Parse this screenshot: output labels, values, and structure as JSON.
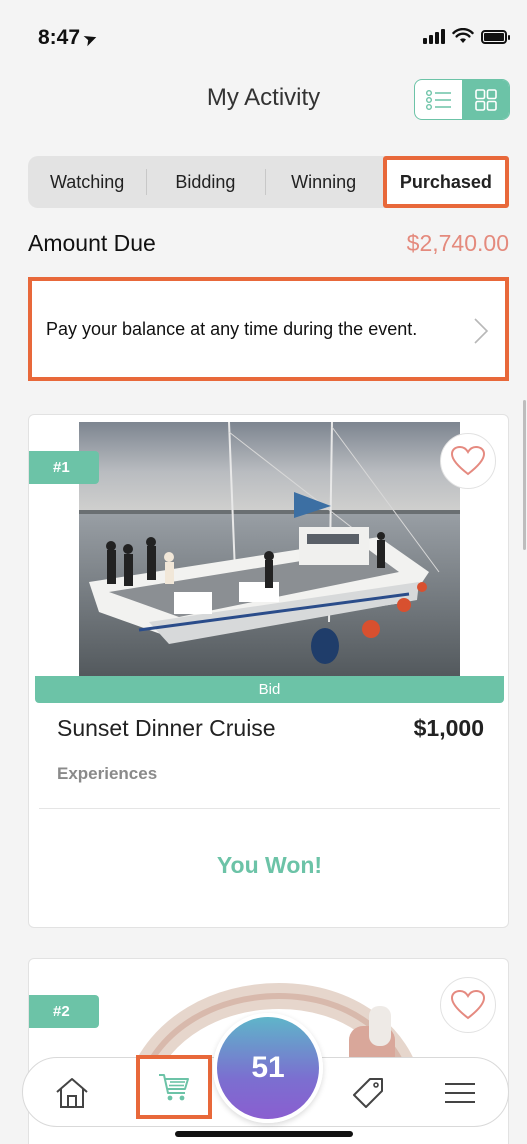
{
  "status_bar": {
    "time": "8:47",
    "location_icon": "location-arrow-icon",
    "icons": [
      "signal-icon",
      "wifi-icon",
      "battery-icon"
    ]
  },
  "header": {
    "title": "My Activity",
    "view_toggle": {
      "options": [
        "list-view-icon",
        "grid-view-icon"
      ],
      "active": "grid-view-icon"
    }
  },
  "tabs": [
    {
      "label": "Watching",
      "active": false
    },
    {
      "label": "Bidding",
      "active": false
    },
    {
      "label": "Winning",
      "active": false
    },
    {
      "label": "Purchased",
      "active": true
    }
  ],
  "amount_due": {
    "label": "Amount Due",
    "value": "$2,740.00"
  },
  "balance_notice": {
    "text": "Pay your balance at any time during the event."
  },
  "items": [
    {
      "rank": "#1",
      "status": "Bid",
      "title": "Sunset Dinner Cruise",
      "price": "$1,000",
      "category": "Experiences",
      "result": "You Won!",
      "image": "catamaran-dinner-photo"
    },
    {
      "rank": "#2",
      "image": "headphones-photo"
    }
  ],
  "bottom_nav": {
    "items": [
      "home-icon",
      "cart-icon",
      "tag-icon",
      "menu-icon"
    ],
    "center_count": "51",
    "active": "cart-icon"
  },
  "colors": {
    "accent": "#6cc3a7",
    "amount": "#e48a7d",
    "highlight_outline": "#e8683a",
    "heart": "#e58a80"
  }
}
